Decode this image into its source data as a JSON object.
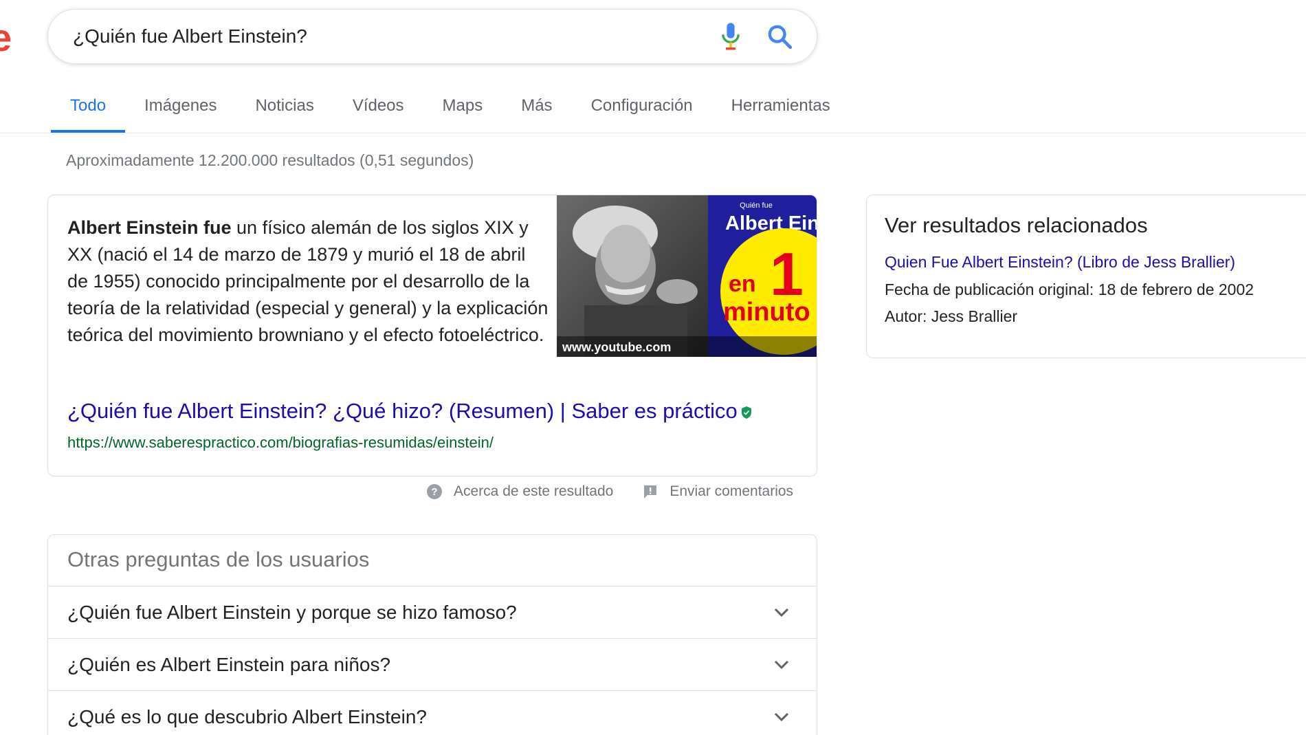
{
  "logo_fragment": "e",
  "search": {
    "value": "¿Quién fue Albert Einstein?"
  },
  "tabs": [
    {
      "label": "Todo",
      "active": true
    },
    {
      "label": "Imágenes"
    },
    {
      "label": "Noticias"
    },
    {
      "label": "Vídeos"
    },
    {
      "label": "Maps"
    },
    {
      "label": "Más"
    },
    {
      "label": "Configuración"
    },
    {
      "label": "Herramientas"
    }
  ],
  "result_stats": "Aproximadamente 12.200.000 resultados (0,51 segundos)",
  "snippet": {
    "bold_lead": "Albert Einstein fue",
    "body": " un físico alemán de los siglos XIX y XX (nació el 14 de marzo de 1879 y murió el 18 de abril de 1955) conocido principalmente por el desarrollo de la teoría de la relatividad (especial y general) y la explicación teórica del movimiento browniano y el efecto fotoeléctrico.",
    "image": {
      "top_caption": "Quién fue",
      "name": "Albert Einstein",
      "badge_number": "1",
      "badge_top": "en",
      "badge_bottom": "minuto",
      "source": "www.youtube.com"
    },
    "link_title": "¿Quién fue Albert Einstein? ¿Qué hizo? (Resumen) | Saber es práctico",
    "url": "https://www.saberespractico.com/biografias-resumidas/einstein/"
  },
  "about": {
    "about_label": "Acerca de este resultado",
    "feedback_label": "Enviar comentarios"
  },
  "related": {
    "title": "Ver resultados relacionados",
    "link": "Quien Fue Albert Einstein? (Libro de Jess Brallier)",
    "pub_label": "Fecha de publicación original",
    "pub_value": ": 18 de febrero de 2002",
    "author_label": "Autor",
    "author_value": ": Jess Brallier"
  },
  "paa": {
    "title": "Otras preguntas de los usuarios",
    "questions": [
      "¿Quién fue Albert Einstein y porque se hizo famoso?",
      "¿Quién es Albert Einstein para niños?",
      "¿Qué es lo que descubrio Albert Einstein?"
    ]
  },
  "colors": {
    "accent": "#1a73e8",
    "link": "#1a0dab",
    "url": "#006621",
    "muted": "#70757a"
  }
}
